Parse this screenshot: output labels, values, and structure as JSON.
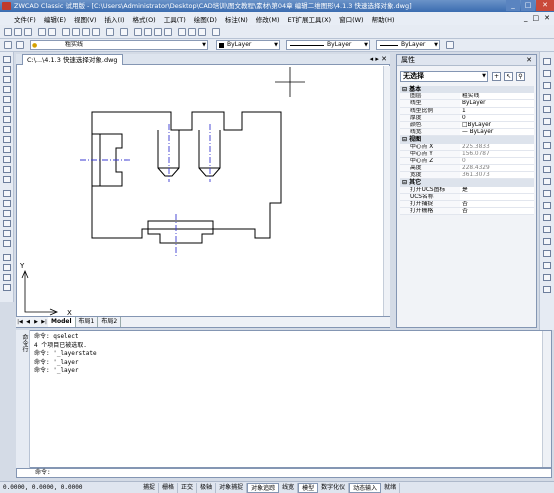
{
  "window": {
    "title": "ZWCAD Classic 试用版 - [C:\\Users\\Administrator\\Desktop\\CAD培训\\图文教程\\素材\\第04章 编辑二维图形\\4.1.3  快速选择对象.dwg]",
    "min": "_",
    "max": "□",
    "close": "✕"
  },
  "menu": {
    "items": [
      "文件(F)",
      "编辑(E)",
      "视图(V)",
      "插入(I)",
      "格式(O)",
      "工具(T)",
      "绘图(D)",
      "标注(N)",
      "修改(M)",
      "ET扩展工具(X)",
      "窗口(W)",
      "帮助(H)"
    ],
    "right_controls": [
      "_",
      "□",
      "✕"
    ]
  },
  "toolbar2": {
    "layer_value": "粗实线",
    "color_value": "ByLayer",
    "linetype_value": "ByLayer",
    "lineweight_value": "ByLayer"
  },
  "document": {
    "tab_title": "C:\\...\\4.1.3  快速选择对象.dwg",
    "controls": "◂ ▸ ✕"
  },
  "layout_tabs": [
    "Model",
    "布局1",
    "布局2"
  ],
  "axes": {
    "y": "Y",
    "x": "X"
  },
  "properties": {
    "header": "属性",
    "close": "✕",
    "selection": "无选择",
    "sections": [
      {
        "title": "基本",
        "rows": [
          {
            "key": "图层",
            "value": "粗实线",
            "dim": false
          },
          {
            "key": "线型",
            "value": "ByLayer",
            "dim": false
          },
          {
            "key": "线型比例",
            "value": "1",
            "dim": false
          },
          {
            "key": "厚度",
            "value": "0",
            "dim": false
          },
          {
            "key": "颜色",
            "value": "□ByLayer",
            "dim": false
          },
          {
            "key": "线宽",
            "value": "— ByLayer",
            "dim": false
          }
        ]
      },
      {
        "title": "视图",
        "rows": [
          {
            "key": "中心点 X",
            "value": "225.3833",
            "dim": true
          },
          {
            "key": "中心点 Y",
            "value": "156.0787",
            "dim": true
          },
          {
            "key": "中心点 Z",
            "value": "0",
            "dim": true
          },
          {
            "key": "高度",
            "value": "228.4329",
            "dim": true
          },
          {
            "key": "宽度",
            "value": "361.3073",
            "dim": true
          }
        ]
      },
      {
        "title": "其它",
        "rows": [
          {
            "key": "打开UCS图标",
            "value": "是",
            "dim": false
          },
          {
            "key": "UCS名称",
            "value": "",
            "dim": false
          },
          {
            "key": "打开捕捉",
            "value": "否",
            "dim": false
          },
          {
            "key": "打开栅格",
            "value": "否",
            "dim": false
          }
        ]
      }
    ]
  },
  "command": {
    "side_label": "命令行",
    "lines": [
      "命令: qselect",
      "4 个项目已被选取.",
      "命令: '_layerstate",
      "命令: '_layer",
      "命令: '_layer"
    ],
    "prompt": "命令:"
  },
  "status": {
    "coords": "0.0000, 0.0000, 0.0000",
    "buttons": [
      {
        "label": "捕捉",
        "on": false
      },
      {
        "label": "栅格",
        "on": false
      },
      {
        "label": "正交",
        "on": false
      },
      {
        "label": "极轴",
        "on": false
      },
      {
        "label": "对象捕捉",
        "on": false
      },
      {
        "label": "对象追踪",
        "on": true
      },
      {
        "label": "线宽",
        "on": false
      },
      {
        "label": "模型",
        "on": true
      },
      {
        "label": "数字化仪",
        "on": false
      },
      {
        "label": "动态输入",
        "on": true
      },
      {
        "label": "就绪",
        "on": false
      }
    ]
  }
}
